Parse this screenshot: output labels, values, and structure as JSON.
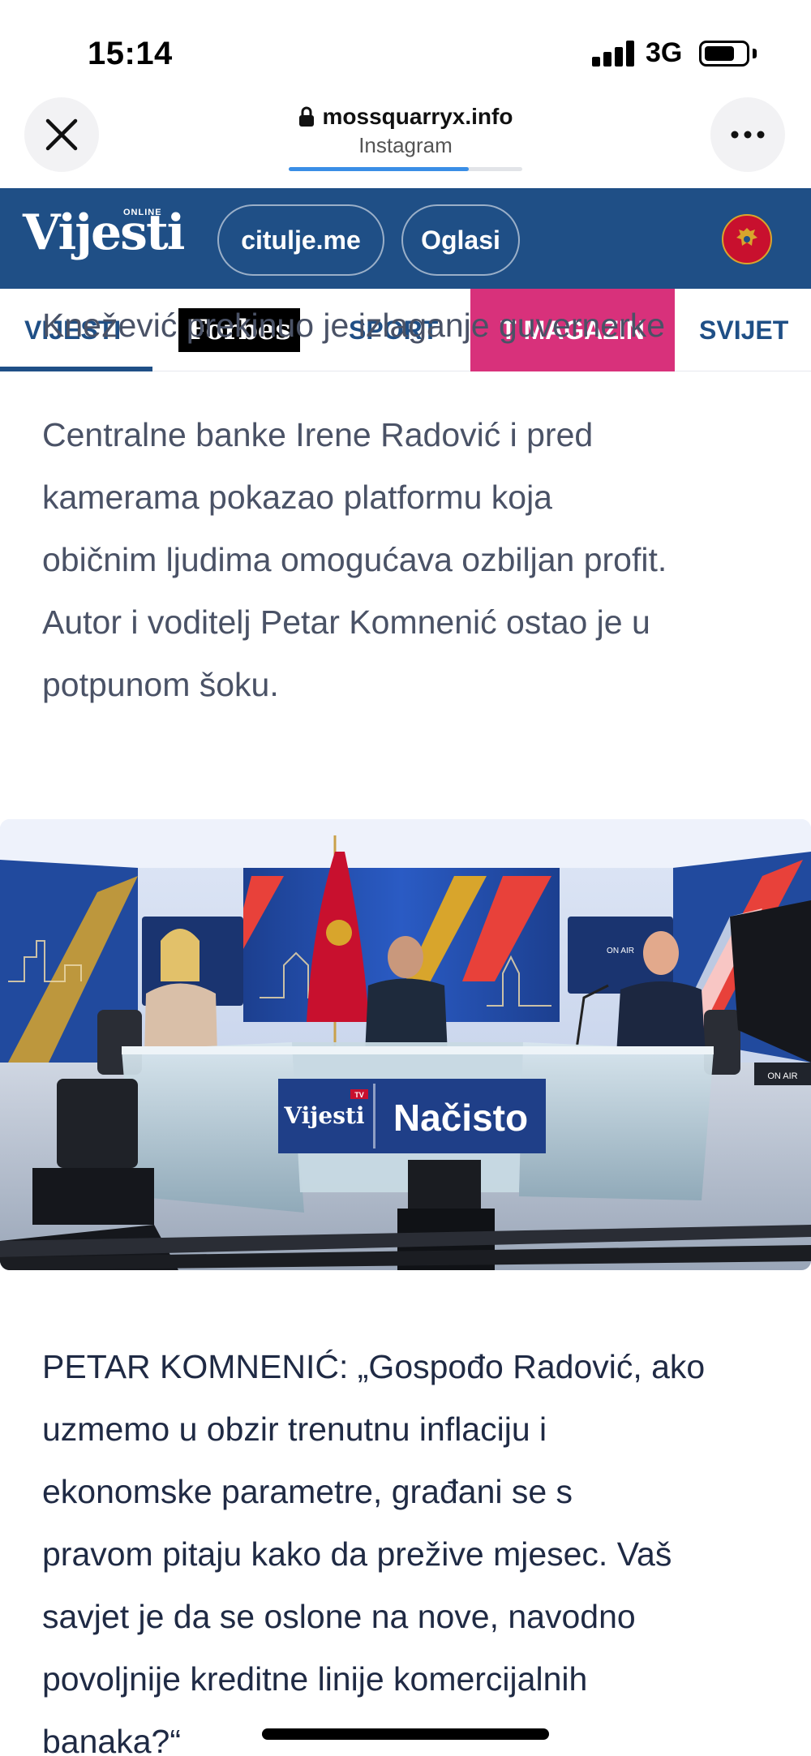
{
  "status_bar": {
    "time": "15:14",
    "network": "3G",
    "battery_level": 0.7
  },
  "browser": {
    "url": "mossquarryx.info",
    "app": "Instagram",
    "close_icon": "close-icon",
    "more_icon": "more-icon",
    "lock_icon": "lock-icon",
    "load_progress": 0.77
  },
  "site_header": {
    "logo_text": "Vijesti",
    "logo_badge": "ONLINE",
    "links": [
      "citulje.me",
      "Oglasi"
    ],
    "brand_color": "#1f4f86"
  },
  "nav": {
    "items": [
      "VIJESTI",
      "Forbes",
      "SPORT",
      "T MAGAZIN",
      "SVIJET"
    ],
    "active": "VIJESTI",
    "highlight_color": "#d8317b"
  },
  "article": {
    "para1_partial_top": "Knežević prekinuo je izlaganje guvernerke",
    "para1_lines": [
      "Centralne banke Irene Radović i pred",
      "kamerama pokazao platformu koja",
      "običnim ljudima omogućava ozbiljan profit.",
      "Autor i voditelj Petar Komnenić ostao je u",
      "potpunom šoku."
    ],
    "image": {
      "studio_logo": "Vijesti",
      "studio_logo_tv": "TV",
      "show_name": "Načisto",
      "monitor_label": "ON AIR",
      "camera_label": "ON AIR"
    },
    "para2_lines": [
      "PETAR KOMNENIĆ: „Gospođo Radović, ako",
      "uzmemo u obzir trenutnu inflaciju i",
      "ekonomske parametre, građani se s",
      "pravom pitaju kako da prežive mjesec. Vaš",
      "savjet je da se oslone na nove, navodno",
      "povoljnije kreditne linije komercijalnih",
      "banaka?“"
    ]
  }
}
